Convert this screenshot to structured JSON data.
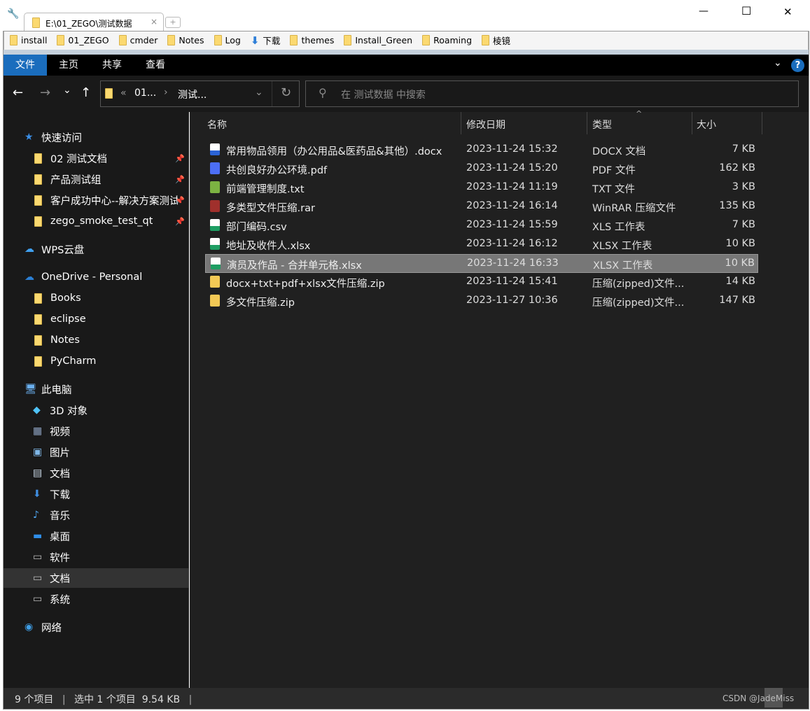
{
  "window": {
    "tab_title": "E:\\01_ZEGO\\测试数据",
    "minimize": "—",
    "maximize": "☐",
    "close": "✕",
    "tab_close": "×",
    "new_tab": "+"
  },
  "bookmarks": [
    {
      "label": "install",
      "icon": "folder"
    },
    {
      "label": "01_ZEGO",
      "icon": "folder"
    },
    {
      "label": "cmder",
      "icon": "folder"
    },
    {
      "label": "Notes",
      "icon": "folder"
    },
    {
      "label": "Log",
      "icon": "folder"
    },
    {
      "label": "下载",
      "icon": "download"
    },
    {
      "label": "themes",
      "icon": "folder"
    },
    {
      "label": "Install_Green",
      "icon": "folder"
    },
    {
      "label": "Roaming",
      "icon": "folder"
    },
    {
      "label": "棱镜",
      "icon": "folder"
    }
  ],
  "ribbon": {
    "tabs": [
      "文件",
      "主页",
      "共享",
      "查看"
    ],
    "help": "?"
  },
  "nav": {
    "back": "←",
    "forward": "→",
    "recent": "⌄",
    "up": "↑",
    "crumbs": [
      "«",
      "01...",
      "›",
      "测试..."
    ],
    "refresh": "↻",
    "search_placeholder": "在 测试数据 中搜索"
  },
  "sidebar": [
    {
      "label": "快速访问",
      "icon": "star",
      "level": 0
    },
    {
      "label": "02 测试文档",
      "icon": "folder",
      "level": 1,
      "pinned": true
    },
    {
      "label": "产品测试组",
      "icon": "folder-user",
      "level": 1,
      "pinned": true
    },
    {
      "label": "客户成功中心--解决方案测试",
      "icon": "folder",
      "level": 1,
      "pinned": true
    },
    {
      "label": "zego_smoke_test_qt",
      "icon": "folder",
      "level": 1,
      "pinned": true
    },
    {
      "label": "WPS云盘",
      "icon": "cloud",
      "level": 0,
      "gap": true
    },
    {
      "label": "OneDrive - Personal",
      "icon": "onedrive",
      "level": 0,
      "gap": true
    },
    {
      "label": "Books",
      "icon": "folder",
      "level": 1
    },
    {
      "label": "eclipse",
      "icon": "folder",
      "level": 1
    },
    {
      "label": "Notes",
      "icon": "folder",
      "level": 1
    },
    {
      "label": "PyCharm",
      "icon": "folder",
      "level": 1
    },
    {
      "label": "此电脑",
      "icon": "computer",
      "level": 0,
      "gap": true
    },
    {
      "label": "3D 对象",
      "icon": "cube",
      "level": 1
    },
    {
      "label": "视频",
      "icon": "video",
      "level": 1
    },
    {
      "label": "图片",
      "icon": "picture",
      "level": 1
    },
    {
      "label": "文档",
      "icon": "document",
      "level": 1
    },
    {
      "label": "下载",
      "icon": "download",
      "level": 1
    },
    {
      "label": "音乐",
      "icon": "music",
      "level": 1
    },
    {
      "label": "桌面",
      "icon": "desktop",
      "level": 1
    },
    {
      "label": "软件",
      "icon": "drive",
      "level": 1
    },
    {
      "label": "文档",
      "icon": "drive",
      "level": 1,
      "selected": true
    },
    {
      "label": "系统",
      "icon": "drive",
      "level": 1
    },
    {
      "label": "网络",
      "icon": "network",
      "level": 0,
      "gap": true
    }
  ],
  "columns": {
    "name": "名称",
    "date": "修改日期",
    "type": "类型",
    "size": "大小"
  },
  "files": [
    {
      "name": "常用物品领用（办公用品&医药品&其他）.docx",
      "date": "2023-11-24 15:32",
      "type": "DOCX 文档",
      "size": "7 KB",
      "icon": "word",
      "color": "#2b63d6"
    },
    {
      "name": "共创良好办公环境.pdf",
      "date": "2023-11-24 15:20",
      "type": "PDF 文件",
      "size": "162 KB",
      "icon": "pdf",
      "color": "#4c6ef5"
    },
    {
      "name": "前端管理制度.txt",
      "date": "2023-11-24 11:19",
      "type": "TXT 文件",
      "size": "3 KB",
      "icon": "text",
      "color": "#7cb342"
    },
    {
      "name": "多类型文件压缩.rar",
      "date": "2023-11-24 16:14",
      "type": "WinRAR 压缩文件",
      "size": "135 KB",
      "icon": "winrar",
      "color": "#a0302c"
    },
    {
      "name": "部门编码.csv",
      "date": "2023-11-24 15:59",
      "type": "XLS 工作表",
      "size": "7 KB",
      "icon": "spreadsheet",
      "color": "#1e9e63"
    },
    {
      "name": "地址及收件人.xlsx",
      "date": "2023-11-24 16:12",
      "type": "XLSX 工作表",
      "size": "10 KB",
      "icon": "spreadsheet",
      "color": "#1e9e63"
    },
    {
      "name": "演员及作品 - 合并单元格.xlsx",
      "date": "2023-11-24 16:33",
      "type": "XLSX 工作表",
      "size": "10 KB",
      "icon": "spreadsheet",
      "color": "#1e9e63",
      "selected": true
    },
    {
      "name": "docx+txt+pdf+xlsx文件压缩.zip",
      "date": "2023-11-24 15:41",
      "type": "压缩(zipped)文件...",
      "size": "14 KB",
      "icon": "zip",
      "color": "#f3c955"
    },
    {
      "name": "多文件压缩.zip",
      "date": "2023-11-27 10:36",
      "type": "压缩(zipped)文件...",
      "size": "147 KB",
      "icon": "zip",
      "color": "#f3c955"
    }
  ],
  "status": {
    "count": "9 个项目",
    "selected": "选中 1 个项目  9.54 KB",
    "watermark": "CSDN @JadeMiss"
  }
}
